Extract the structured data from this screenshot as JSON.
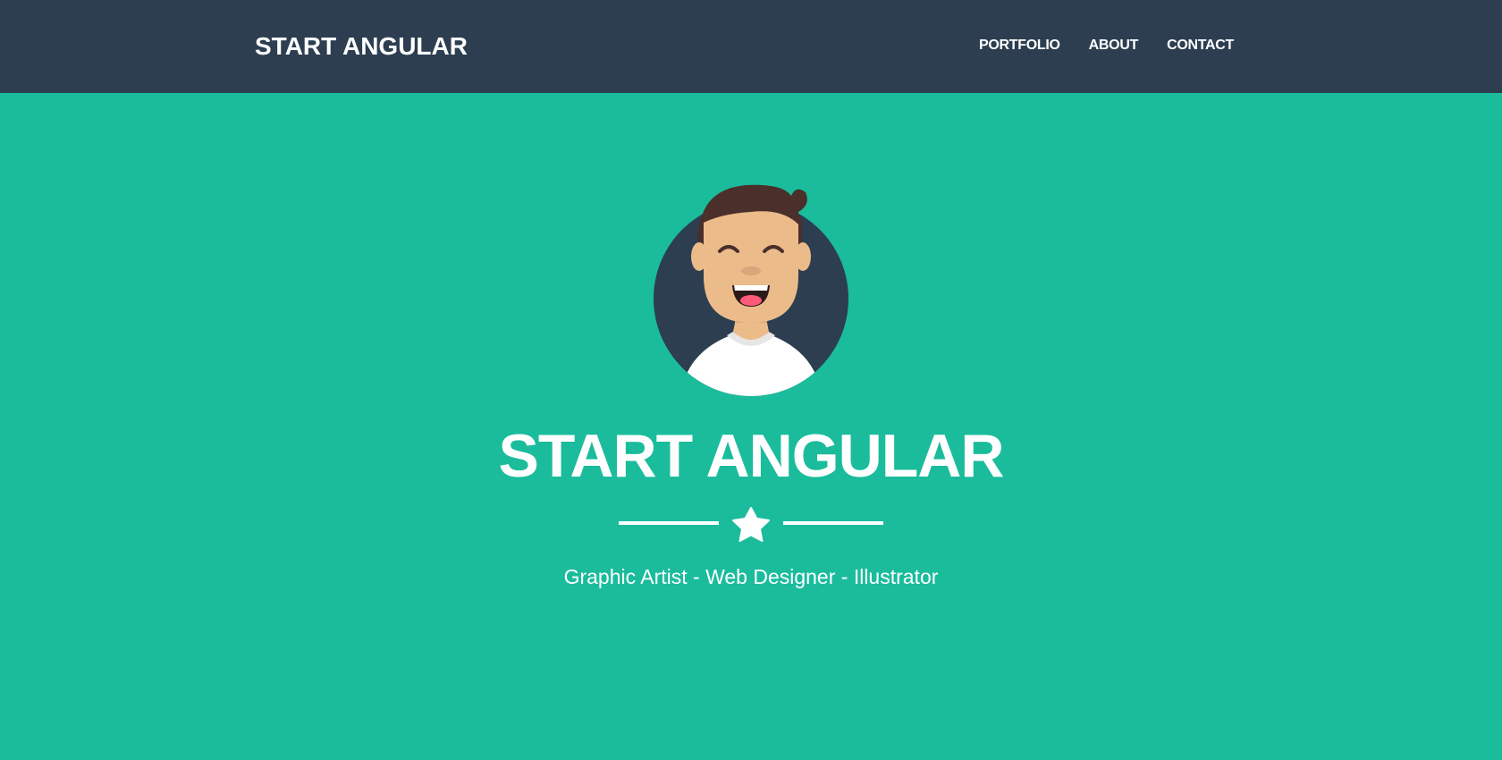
{
  "navbar": {
    "brand": "START ANGULAR",
    "items": [
      {
        "label": "PORTFOLIO"
      },
      {
        "label": "ABOUT"
      },
      {
        "label": "CONTACT"
      }
    ]
  },
  "hero": {
    "avatar_icon": "person-avatar-icon",
    "title": "START ANGULAR",
    "divider_icon": "star-icon",
    "subtitle": "Graphic Artist - Web Designer - Illustrator"
  },
  "colors": {
    "navbar_bg": "#2c3e50",
    "hero_bg": "#1abc9c",
    "text": "#ffffff",
    "avatar_circle": "#2c3e50",
    "hair": "#4a2f2a",
    "skin": "#ecbb8a"
  }
}
